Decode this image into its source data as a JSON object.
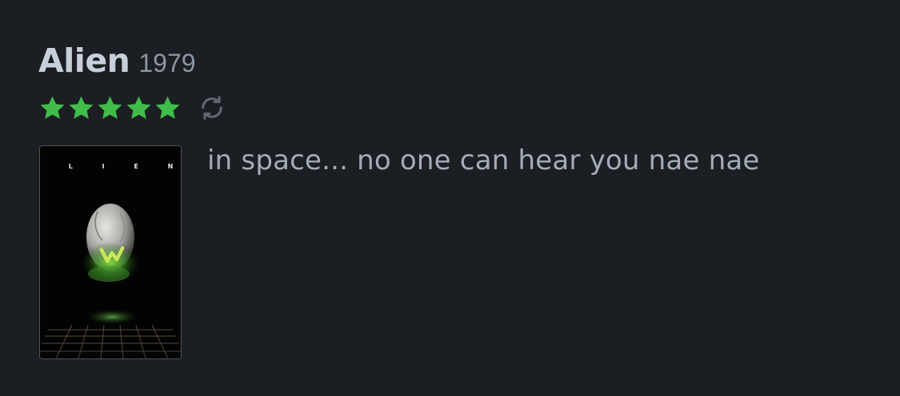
{
  "film": {
    "title": "Alien",
    "year": "1979",
    "rating_stars": 5,
    "rating_max": 5,
    "poster_logo_text": "A L I E N"
  },
  "review": {
    "text": "in space... no one can hear you nae nae"
  },
  "icons": {
    "star": "star-icon",
    "rewatch": "rewatch-icon"
  },
  "colors": {
    "background": "#1b1e22",
    "star": "#40bc4a",
    "title": "#c7d0da",
    "muted": "#8b96a2"
  }
}
